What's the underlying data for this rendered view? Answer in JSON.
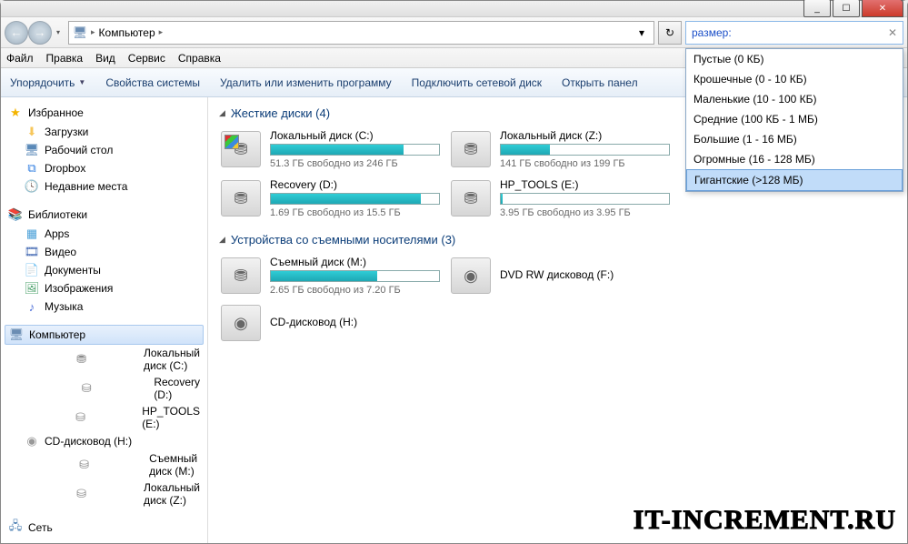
{
  "window_controls": {
    "min": "_",
    "max": "☐",
    "close": "✕"
  },
  "nav": {
    "back": "←",
    "forward": "→",
    "dd": "▾"
  },
  "address": {
    "computer_icon": "🖥",
    "path": "Компьютер",
    "sep": "▸",
    "dd": "▾"
  },
  "refresh": "↻",
  "search": {
    "value": "размер:",
    "clear": "✕"
  },
  "menu": [
    "Файл",
    "Правка",
    "Вид",
    "Сервис",
    "Справка"
  ],
  "toolbar": {
    "organize": "Упорядочить",
    "sysprops": "Свойства системы",
    "uninstall": "Удалить или изменить программу",
    "mapdrive": "Подключить сетевой диск",
    "panel": "Открыть панел"
  },
  "sidebar": {
    "favorites": "Избранное",
    "fav_items": [
      "Загрузки",
      "Рабочий стол",
      "Dropbox",
      "Недавние места"
    ],
    "libraries": "Библиотеки",
    "lib_items": [
      "Apps",
      "Видео",
      "Документы",
      "Изображения",
      "Музыка"
    ],
    "computer": "Компьютер",
    "comp_items": [
      "Локальный диск (C:)",
      "Recovery (D:)",
      "HP_TOOLS (E:)",
      "CD-дисковод (H:)",
      "Съемный диск (M:)",
      "Локальный диск (Z:)"
    ],
    "network": "Сеть"
  },
  "sections": {
    "hdd": {
      "title": "Жесткие диски (4)",
      "drives": [
        {
          "name": "Локальный диск (C:)",
          "stat": "51.3 ГБ свободно из 246 ГБ",
          "fill": 79
        },
        {
          "name": "Локальный диск (Z:)",
          "stat": "141 ГБ свободно из 199 ГБ",
          "fill": 29
        },
        {
          "name": "Recovery (D:)",
          "stat": "1.69 ГБ свободно из 15.5 ГБ",
          "fill": 89
        },
        {
          "name": "HP_TOOLS (E:)",
          "stat": "3.95 ГБ свободно из 3.95 ГБ",
          "fill": 1
        }
      ]
    },
    "removable": {
      "title": "Устройства со съемными носителями (3)",
      "drives": [
        {
          "name": "Съемный диск (M:)",
          "stat": "2.65 ГБ свободно из 7.20 ГБ",
          "fill": 63,
          "bar": true
        },
        {
          "name": "DVD RW дисковод (F:)",
          "stat": "",
          "bar": false,
          "dvd": true
        },
        {
          "name": "CD-дисковод (H:)",
          "stat": "",
          "bar": false,
          "dvd": true
        }
      ]
    }
  },
  "dropdown": [
    "Пустые (0 КБ)",
    "Крошечные (0 - 10 КБ)",
    "Маленькие (10 - 100 КБ)",
    "Средние (100 КБ - 1 МБ)",
    "Большие (1 - 16 МБ)",
    "Огромные (16 - 128 МБ)",
    "Гигантские (>128 МБ)"
  ],
  "dropdown_selected": 6,
  "watermark": "IT-INCREMENT.RU"
}
